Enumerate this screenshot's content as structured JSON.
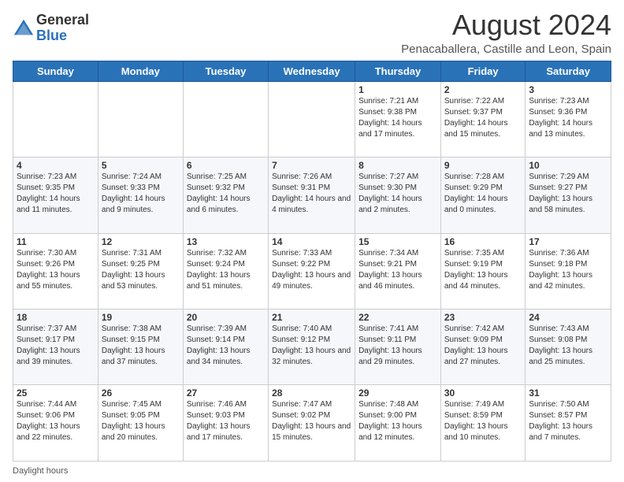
{
  "logo": {
    "general": "General",
    "blue": "Blue"
  },
  "title": "August 2024",
  "subtitle": "Penacaballera, Castille and Leon, Spain",
  "days_header": [
    "Sunday",
    "Monday",
    "Tuesday",
    "Wednesday",
    "Thursday",
    "Friday",
    "Saturday"
  ],
  "weeks": [
    [
      {
        "day": "",
        "sunrise": "",
        "sunset": "",
        "daylight": ""
      },
      {
        "day": "",
        "sunrise": "",
        "sunset": "",
        "daylight": ""
      },
      {
        "day": "",
        "sunrise": "",
        "sunset": "",
        "daylight": ""
      },
      {
        "day": "",
        "sunrise": "",
        "sunset": "",
        "daylight": ""
      },
      {
        "day": "1",
        "sunrise": "Sunrise: 7:21 AM",
        "sunset": "Sunset: 9:38 PM",
        "daylight": "Daylight: 14 hours and 17 minutes."
      },
      {
        "day": "2",
        "sunrise": "Sunrise: 7:22 AM",
        "sunset": "Sunset: 9:37 PM",
        "daylight": "Daylight: 14 hours and 15 minutes."
      },
      {
        "day": "3",
        "sunrise": "Sunrise: 7:23 AM",
        "sunset": "Sunset: 9:36 PM",
        "daylight": "Daylight: 14 hours and 13 minutes."
      }
    ],
    [
      {
        "day": "4",
        "sunrise": "Sunrise: 7:23 AM",
        "sunset": "Sunset: 9:35 PM",
        "daylight": "Daylight: 14 hours and 11 minutes."
      },
      {
        "day": "5",
        "sunrise": "Sunrise: 7:24 AM",
        "sunset": "Sunset: 9:33 PM",
        "daylight": "Daylight: 14 hours and 9 minutes."
      },
      {
        "day": "6",
        "sunrise": "Sunrise: 7:25 AM",
        "sunset": "Sunset: 9:32 PM",
        "daylight": "Daylight: 14 hours and 6 minutes."
      },
      {
        "day": "7",
        "sunrise": "Sunrise: 7:26 AM",
        "sunset": "Sunset: 9:31 PM",
        "daylight": "Daylight: 14 hours and 4 minutes."
      },
      {
        "day": "8",
        "sunrise": "Sunrise: 7:27 AM",
        "sunset": "Sunset: 9:30 PM",
        "daylight": "Daylight: 14 hours and 2 minutes."
      },
      {
        "day": "9",
        "sunrise": "Sunrise: 7:28 AM",
        "sunset": "Sunset: 9:29 PM",
        "daylight": "Daylight: 14 hours and 0 minutes."
      },
      {
        "day": "10",
        "sunrise": "Sunrise: 7:29 AM",
        "sunset": "Sunset: 9:27 PM",
        "daylight": "Daylight: 13 hours and 58 minutes."
      }
    ],
    [
      {
        "day": "11",
        "sunrise": "Sunrise: 7:30 AM",
        "sunset": "Sunset: 9:26 PM",
        "daylight": "Daylight: 13 hours and 55 minutes."
      },
      {
        "day": "12",
        "sunrise": "Sunrise: 7:31 AM",
        "sunset": "Sunset: 9:25 PM",
        "daylight": "Daylight: 13 hours and 53 minutes."
      },
      {
        "day": "13",
        "sunrise": "Sunrise: 7:32 AM",
        "sunset": "Sunset: 9:24 PM",
        "daylight": "Daylight: 13 hours and 51 minutes."
      },
      {
        "day": "14",
        "sunrise": "Sunrise: 7:33 AM",
        "sunset": "Sunset: 9:22 PM",
        "daylight": "Daylight: 13 hours and 49 minutes."
      },
      {
        "day": "15",
        "sunrise": "Sunrise: 7:34 AM",
        "sunset": "Sunset: 9:21 PM",
        "daylight": "Daylight: 13 hours and 46 minutes."
      },
      {
        "day": "16",
        "sunrise": "Sunrise: 7:35 AM",
        "sunset": "Sunset: 9:19 PM",
        "daylight": "Daylight: 13 hours and 44 minutes."
      },
      {
        "day": "17",
        "sunrise": "Sunrise: 7:36 AM",
        "sunset": "Sunset: 9:18 PM",
        "daylight": "Daylight: 13 hours and 42 minutes."
      }
    ],
    [
      {
        "day": "18",
        "sunrise": "Sunrise: 7:37 AM",
        "sunset": "Sunset: 9:17 PM",
        "daylight": "Daylight: 13 hours and 39 minutes."
      },
      {
        "day": "19",
        "sunrise": "Sunrise: 7:38 AM",
        "sunset": "Sunset: 9:15 PM",
        "daylight": "Daylight: 13 hours and 37 minutes."
      },
      {
        "day": "20",
        "sunrise": "Sunrise: 7:39 AM",
        "sunset": "Sunset: 9:14 PM",
        "daylight": "Daylight: 13 hours and 34 minutes."
      },
      {
        "day": "21",
        "sunrise": "Sunrise: 7:40 AM",
        "sunset": "Sunset: 9:12 PM",
        "daylight": "Daylight: 13 hours and 32 minutes."
      },
      {
        "day": "22",
        "sunrise": "Sunrise: 7:41 AM",
        "sunset": "Sunset: 9:11 PM",
        "daylight": "Daylight: 13 hours and 29 minutes."
      },
      {
        "day": "23",
        "sunrise": "Sunrise: 7:42 AM",
        "sunset": "Sunset: 9:09 PM",
        "daylight": "Daylight: 13 hours and 27 minutes."
      },
      {
        "day": "24",
        "sunrise": "Sunrise: 7:43 AM",
        "sunset": "Sunset: 9:08 PM",
        "daylight": "Daylight: 13 hours and 25 minutes."
      }
    ],
    [
      {
        "day": "25",
        "sunrise": "Sunrise: 7:44 AM",
        "sunset": "Sunset: 9:06 PM",
        "daylight": "Daylight: 13 hours and 22 minutes."
      },
      {
        "day": "26",
        "sunrise": "Sunrise: 7:45 AM",
        "sunset": "Sunset: 9:05 PM",
        "daylight": "Daylight: 13 hours and 20 minutes."
      },
      {
        "day": "27",
        "sunrise": "Sunrise: 7:46 AM",
        "sunset": "Sunset: 9:03 PM",
        "daylight": "Daylight: 13 hours and 17 minutes."
      },
      {
        "day": "28",
        "sunrise": "Sunrise: 7:47 AM",
        "sunset": "Sunset: 9:02 PM",
        "daylight": "Daylight: 13 hours and 15 minutes."
      },
      {
        "day": "29",
        "sunrise": "Sunrise: 7:48 AM",
        "sunset": "Sunset: 9:00 PM",
        "daylight": "Daylight: 13 hours and 12 minutes."
      },
      {
        "day": "30",
        "sunrise": "Sunrise: 7:49 AM",
        "sunset": "Sunset: 8:59 PM",
        "daylight": "Daylight: 13 hours and 10 minutes."
      },
      {
        "day": "31",
        "sunrise": "Sunrise: 7:50 AM",
        "sunset": "Sunset: 8:57 PM",
        "daylight": "Daylight: 13 hours and 7 minutes."
      }
    ]
  ],
  "footer": {
    "daylight_label": "Daylight hours"
  }
}
